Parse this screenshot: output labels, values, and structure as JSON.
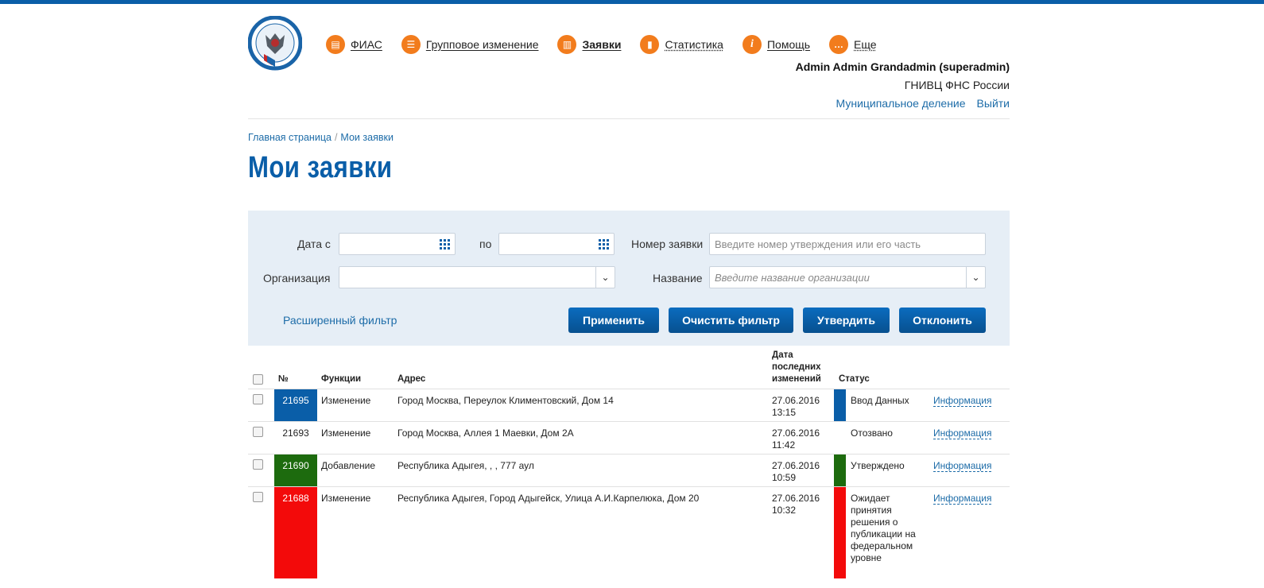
{
  "header": {
    "nav": [
      {
        "icon": "fias-icon",
        "glyph": "▤",
        "label": "ФИАС",
        "active": false,
        "dotted": false
      },
      {
        "icon": "group-change-icon",
        "glyph": "☰",
        "label": "Групповое изменение",
        "active": false,
        "dotted": false
      },
      {
        "icon": "requests-icon",
        "glyph": "▥",
        "label": "Заявки",
        "active": true,
        "dotted": false
      },
      {
        "icon": "statistics-icon",
        "glyph": "▮",
        "label": "Статистика",
        "active": false,
        "dotted": true
      },
      {
        "icon": "help-icon",
        "glyph": "i",
        "label": "Помощь",
        "active": false,
        "dotted": false
      },
      {
        "icon": "more-icon",
        "glyph": "…",
        "label": "Еще",
        "active": false,
        "dotted": true
      }
    ],
    "user_name": "Admin Admin Grandadmin (superadmin)",
    "user_org": "ГНИВЦ ФНС России",
    "link_municipal": "Муниципальное деление",
    "link_logout": "Выйти"
  },
  "breadcrumb": {
    "home": "Главная страница",
    "sep": "/",
    "current": "Мои заявки"
  },
  "page_title": "Мои заявки",
  "filter": {
    "date_from_label": "Дата с",
    "date_to_label": "по",
    "number_label": "Номер заявки",
    "number_placeholder": "Введите номер утверждения или его часть",
    "org_label": "Организация",
    "name_label": "Название",
    "name_placeholder": "Введите название организации",
    "advanced_link": "Расширенный фильтр",
    "buttons": {
      "apply": "Применить",
      "clear": "Очистить фильтр",
      "approve": "Утвердить",
      "reject": "Отклонить"
    }
  },
  "table": {
    "headers": {
      "num": "№",
      "func": "Функции",
      "addr": "Адрес",
      "date": "Дата последних изменений",
      "status": "Статус"
    },
    "rows": [
      {
        "num": "21695",
        "func": "Изменение",
        "addr": "Город Москва, Переулок Климентовский, Дом 14",
        "date": "27.06.2016 13:15",
        "status": "Ввод Данных",
        "color": "#0a5ea8",
        "info": "Информация"
      },
      {
        "num": "21693",
        "func": "Изменение",
        "addr": "Город Москва, Аллея 1 Маевки, Дом 2А",
        "date": "27.06.2016 11:42",
        "status": "Отозвано",
        "color": "",
        "info": "Информация"
      },
      {
        "num": "21690",
        "func": "Добавление",
        "addr": "Республика Адыгея, , , 777 аул",
        "date": "27.06.2016 10:59",
        "status": "Утверждено",
        "color": "#1d6b0e",
        "info": "Информация"
      },
      {
        "num": "21688",
        "func": "Изменение",
        "addr": "Республика Адыгея, Город Адыгейск, Улица А.И.Карпелюка, Дом 20",
        "date": "27.06.2016 10:32",
        "status": "Ожидает принятия решения о публикации на федеральном уровне",
        "color": "#f30a0a",
        "info": "Информация"
      }
    ]
  }
}
